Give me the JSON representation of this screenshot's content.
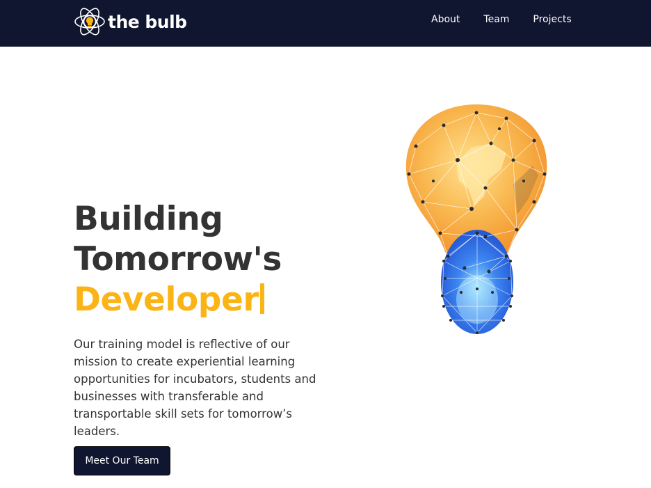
{
  "nav": {
    "brand": "the bulb",
    "links": [
      "About",
      "Team",
      "Projects"
    ]
  },
  "hero": {
    "title_line1": "Building",
    "title_line2": "Tomorrow's",
    "title_highlight": "Developer",
    "description": "Our training model is reflective of our mission to create experiential learning opportunities for incubators, students and businesses with transferable and transportable skill sets for tomorrow’s leaders.",
    "cta": "Meet Our Team"
  },
  "colors": {
    "navbar_bg": "#101530",
    "accent": "#fbb415",
    "text": "#333333",
    "button_bg": "#101530",
    "bulb_orange": "#f8a43a",
    "bulb_blue": "#2f6fe0"
  },
  "icons": {
    "brand_logo": "atom-bulb-icon",
    "illustration": "polygon-lightbulb-africa"
  }
}
